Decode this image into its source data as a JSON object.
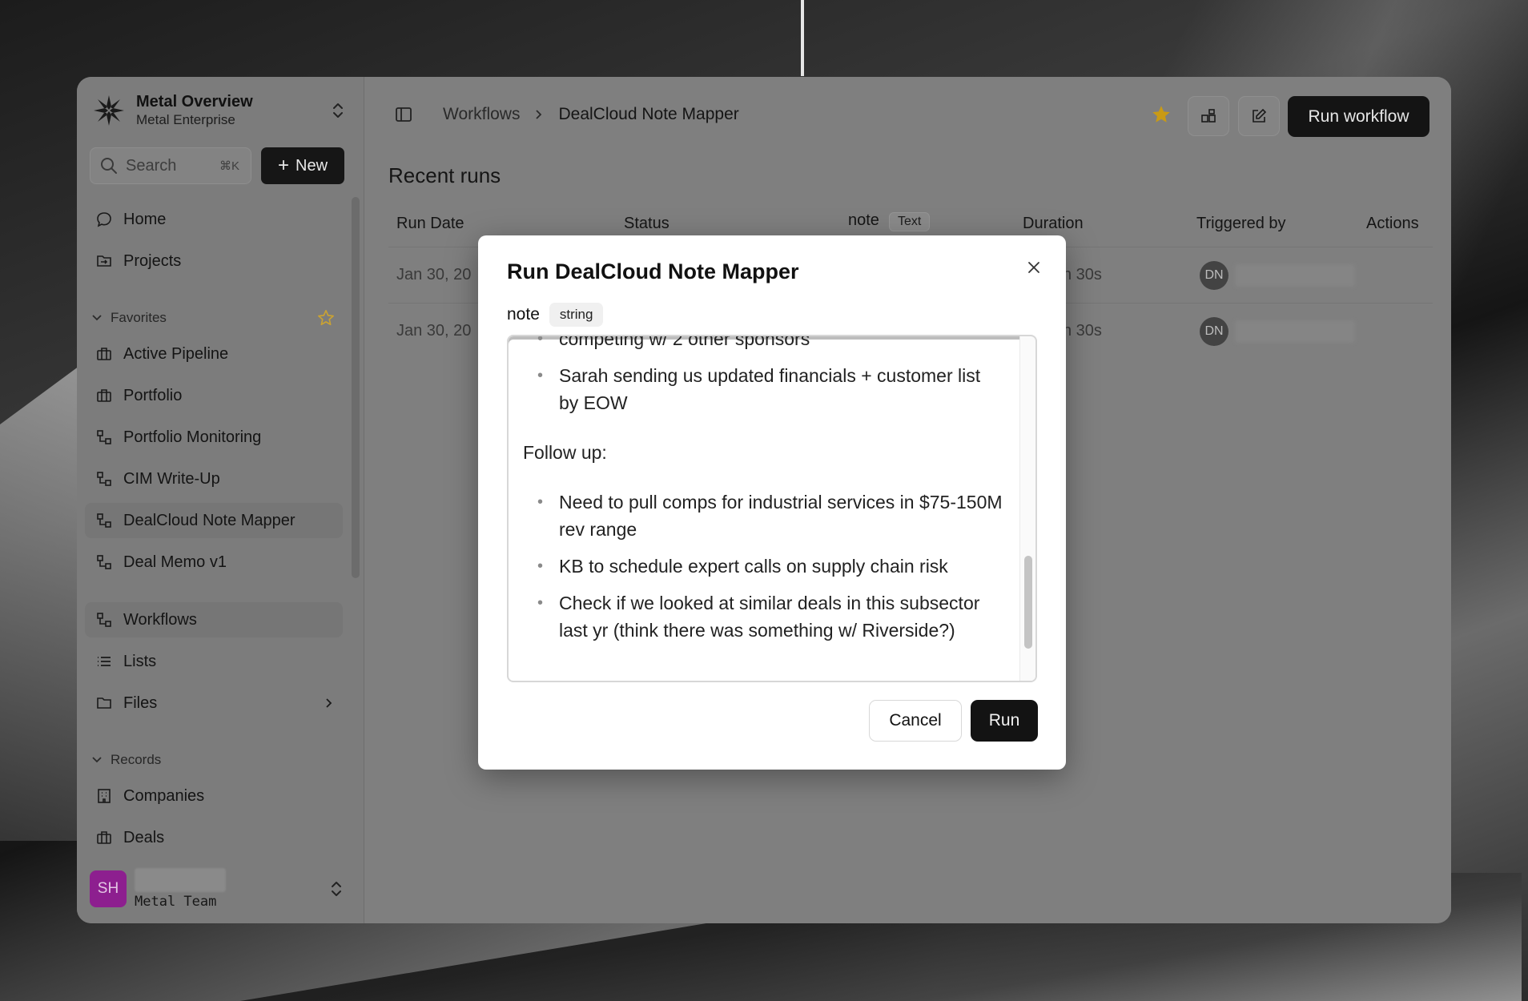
{
  "org": {
    "name": "Metal Overview",
    "subtitle": "Metal Enterprise"
  },
  "search": {
    "label": "Search",
    "shortcut": "⌘K"
  },
  "new_button": "New",
  "nav": {
    "home": "Home",
    "projects": "Projects",
    "favorites_label": "Favorites",
    "favorites": [
      "Active Pipeline",
      "Portfolio",
      "Portfolio Monitoring",
      "CIM Write-Up",
      "DealCloud Note Mapper",
      "Deal Memo v1"
    ],
    "workflows": "Workflows",
    "lists": "Lists",
    "files": "Files",
    "records_label": "Records",
    "companies": "Companies",
    "deals": "Deals"
  },
  "user": {
    "initials": "SH",
    "team": "Metal Team"
  },
  "breadcrumb": {
    "parent": "Workflows",
    "current": "DealCloud Note Mapper"
  },
  "run_workflow_label": "Run workflow",
  "recent_runs": {
    "title": "Recent runs",
    "columns": {
      "run_date": "Run Date",
      "status": "Status",
      "note": "note",
      "note_type": "Text",
      "duration": "Duration",
      "triggered_by": "Triggered by",
      "actions": "Actions"
    },
    "rows": [
      {
        "run_date": "Jan 30, 20",
        "duration": "n 30s",
        "initials": "DN"
      },
      {
        "run_date": "Jan 30, 20",
        "duration": "n 30s",
        "initials": "DN"
      }
    ]
  },
  "modal": {
    "title": "Run DealCloud Note Mapper",
    "field_name": "note",
    "field_type": "string",
    "content": {
      "partial_bullet": "competing w/ 2 other sponsors",
      "bullet_1": "Sarah sending us updated financials + customer list by EOW",
      "follow_up_heading": "Follow up:",
      "follow_up_bullets": [
        "Need to pull comps for industrial services in $75-150M rev range",
        "KB to schedule expert calls on supply chain risk",
        "Check if we looked at similar deals in this subsector last yr (think there was something w/ Riverside?)"
      ]
    },
    "cancel_label": "Cancel",
    "run_label": "Run"
  },
  "colors": {
    "accent_star": "#d4a017",
    "primary_button": "#141414",
    "avatar_sh": "#8d1f8f"
  }
}
